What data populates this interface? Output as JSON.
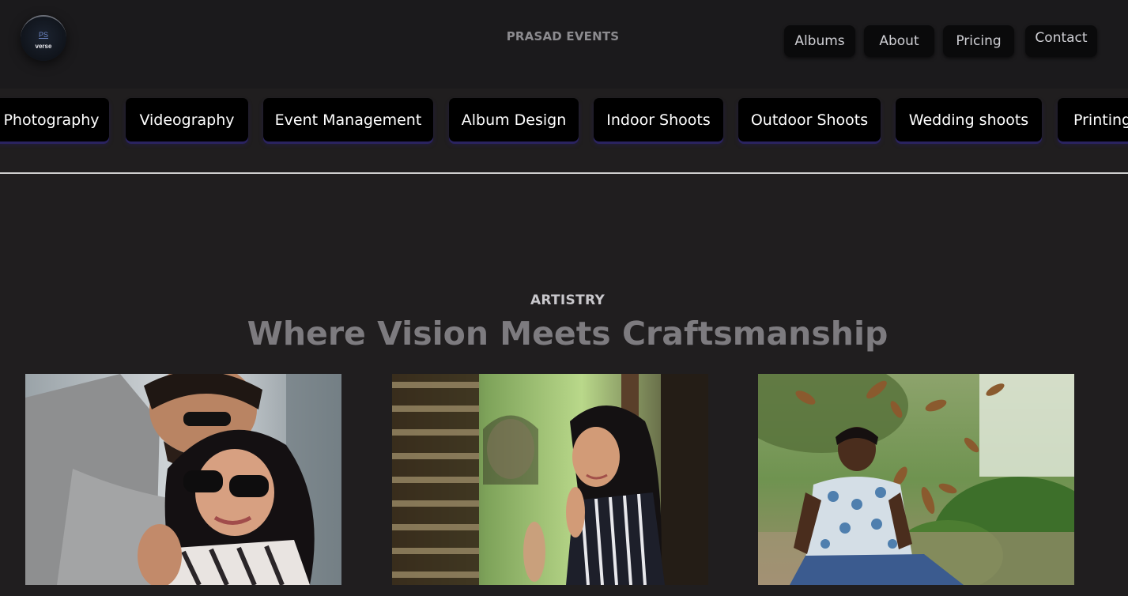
{
  "logo": {
    "mark": "PS",
    "word": "verse"
  },
  "header": {
    "brand": "PRASAD EVENTS"
  },
  "nav": {
    "albums": "Albums",
    "about": "About",
    "pricing": "Pricing",
    "contact": "Contact"
  },
  "services": [
    "Photography",
    "Videography",
    "Event Management",
    "Album Design",
    "Indoor Shoots",
    "Outdoor Shoots",
    "Wedding shoots",
    "Printing"
  ],
  "section": {
    "eyebrow": "ARTISTRY",
    "headline": "Where Vision Meets Craftsmanship"
  }
}
